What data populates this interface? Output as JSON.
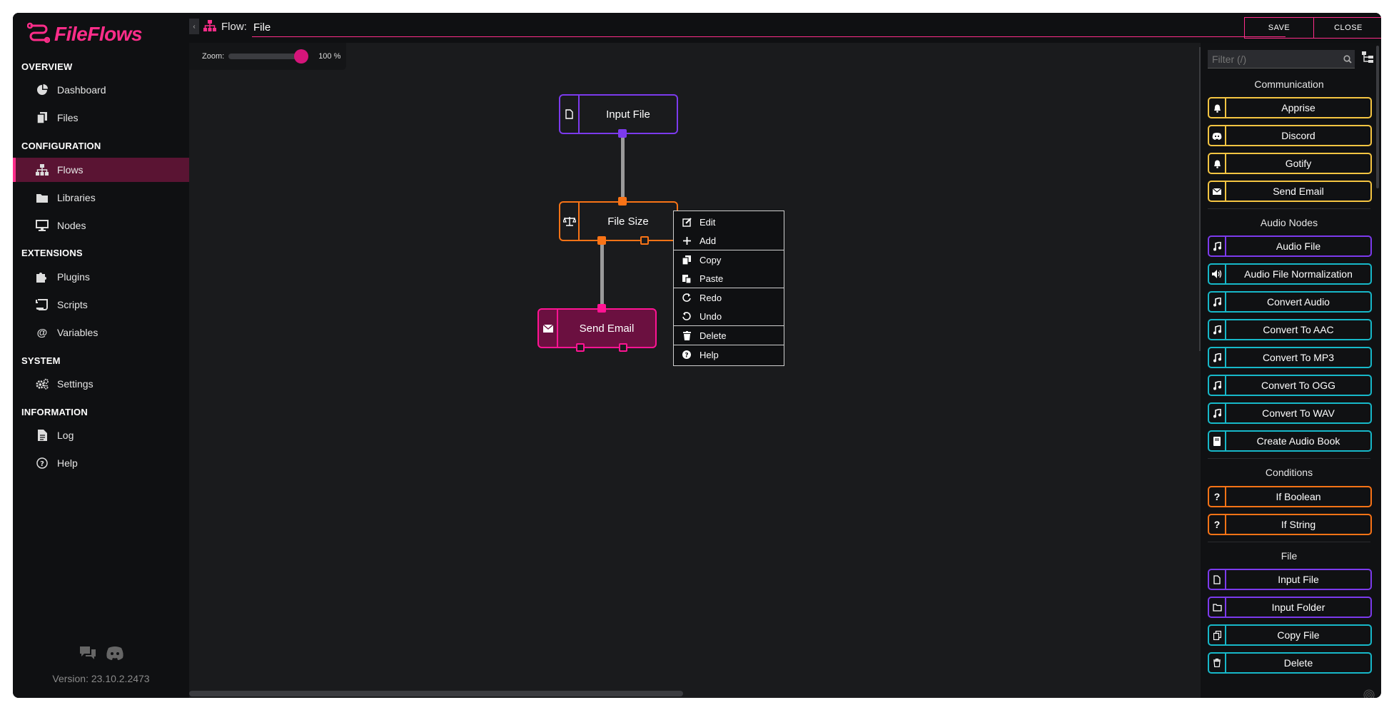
{
  "app": {
    "name": "FileFlows",
    "version": "Version: 23.10.2.2473",
    "accent_color": "#ff2d8a"
  },
  "sidebar": {
    "sections": [
      {
        "title": "OVERVIEW",
        "items": [
          {
            "label": "Dashboard",
            "icon": "pie-chart-icon"
          },
          {
            "label": "Files",
            "icon": "files-icon"
          }
        ]
      },
      {
        "title": "CONFIGURATION",
        "items": [
          {
            "label": "Flows",
            "icon": "sitemap-icon",
            "active": true
          },
          {
            "label": "Libraries",
            "icon": "folder-icon"
          },
          {
            "label": "Nodes",
            "icon": "desktop-icon"
          }
        ]
      },
      {
        "title": "EXTENSIONS",
        "items": [
          {
            "label": "Plugins",
            "icon": "puzzle-icon"
          },
          {
            "label": "Scripts",
            "icon": "scroll-icon"
          },
          {
            "label": "Variables",
            "icon": "at-icon"
          }
        ]
      },
      {
        "title": "SYSTEM",
        "items": [
          {
            "label": "Settings",
            "icon": "cogs-icon"
          }
        ]
      },
      {
        "title": "INFORMATION",
        "items": [
          {
            "label": "Log",
            "icon": "log-file-icon"
          },
          {
            "label": "Help",
            "icon": "question-circle-icon"
          }
        ]
      }
    ]
  },
  "topbar": {
    "flow_label": "Flow:",
    "flow_name": "File",
    "save_label": "SAVE",
    "close_label": "CLOSE"
  },
  "canvas": {
    "zoom_label": "Zoom:",
    "zoom_value": "100 %",
    "zoom_level": 1.0,
    "nodes": [
      {
        "label": "Input File",
        "icon": "file-icon",
        "color": "#7c3aed"
      },
      {
        "label": "File Size",
        "icon": "balance-scale-icon",
        "color": "#f97316"
      },
      {
        "label": "Send Email",
        "icon": "envelope-icon",
        "color": "#ff1493"
      }
    ]
  },
  "context_menu": {
    "items": [
      {
        "label": "Edit",
        "icon": "edit-icon"
      },
      {
        "label": "Add",
        "icon": "plus-icon"
      },
      {
        "label": "Copy",
        "icon": "copy-icon"
      },
      {
        "label": "Paste",
        "icon": "paste-icon"
      },
      {
        "label": "Redo",
        "icon": "redo-icon"
      },
      {
        "label": "Undo",
        "icon": "undo-icon"
      },
      {
        "label": "Delete",
        "icon": "trash-icon"
      },
      {
        "label": "Help",
        "icon": "question-circle-icon"
      }
    ]
  },
  "panel": {
    "filter_placeholder": "Filter (/)",
    "groups": [
      {
        "title": "Communication",
        "items": [
          {
            "label": "Apprise",
            "icon": "bell-icon",
            "color": "#f5c542"
          },
          {
            "label": "Discord",
            "icon": "discord-icon",
            "color": "#f5c542"
          },
          {
            "label": "Gotify",
            "icon": "bell-icon",
            "color": "#f5c542"
          },
          {
            "label": "Send Email",
            "icon": "envelope-icon",
            "color": "#f5c542"
          }
        ]
      },
      {
        "title": "Audio Nodes",
        "items": [
          {
            "label": "Audio File",
            "icon": "music-icon",
            "color": "#7c3aed"
          },
          {
            "label": "Audio File Normalization",
            "icon": "volume-icon",
            "color": "#17b8c9"
          },
          {
            "label": "Convert Audio",
            "icon": "music-icon",
            "color": "#17b8c9"
          },
          {
            "label": "Convert To AAC",
            "icon": "music-icon",
            "color": "#17b8c9"
          },
          {
            "label": "Convert To MP3",
            "icon": "music-icon",
            "color": "#17b8c9"
          },
          {
            "label": "Convert To OGG",
            "icon": "music-icon",
            "color": "#17b8c9"
          },
          {
            "label": "Convert To WAV",
            "icon": "music-icon",
            "color": "#17b8c9"
          },
          {
            "label": "Create Audio Book",
            "icon": "book-icon",
            "color": "#17b8c9"
          }
        ]
      },
      {
        "title": "Conditions",
        "items": [
          {
            "label": "If Boolean",
            "icon": "question-icon",
            "color": "#f97316"
          },
          {
            "label": "If String",
            "icon": "question-icon",
            "color": "#f97316"
          }
        ]
      },
      {
        "title": "File",
        "items": [
          {
            "label": "Input File",
            "icon": "file-icon",
            "color": "#7c3aed"
          },
          {
            "label": "Input Folder",
            "icon": "folder-open-icon",
            "color": "#7c3aed"
          },
          {
            "label": "Copy File",
            "icon": "copy-icon",
            "color": "#17b8c9"
          },
          {
            "label": "Delete",
            "icon": "trash-icon",
            "color": "#17b8c9"
          }
        ]
      }
    ]
  }
}
